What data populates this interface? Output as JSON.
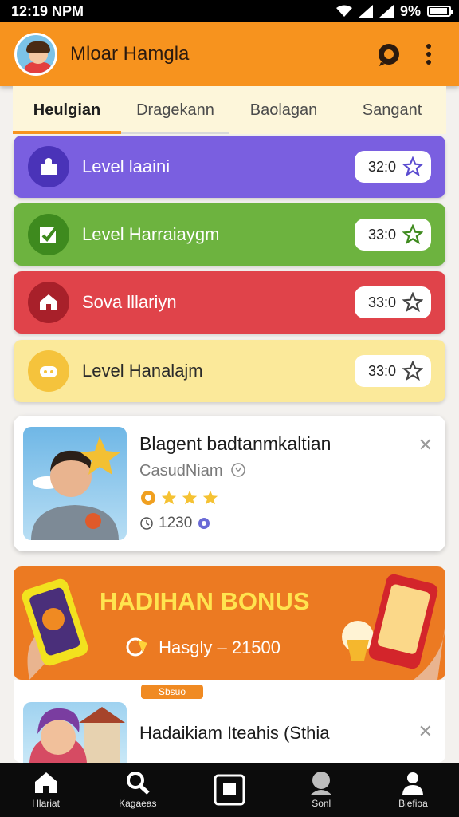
{
  "status_bar": {
    "time": "12:19 NPM",
    "battery": "9%",
    "battery_level": 0.9
  },
  "app_bar": {
    "title": "Mloar Hamgla"
  },
  "tabs": [
    {
      "label": "Heulgian"
    },
    {
      "label": "Dragekann"
    },
    {
      "label": "Baolagan"
    },
    {
      "label": "Sangant"
    }
  ],
  "levels": [
    {
      "label": "Level laaini",
      "count": "32:0",
      "color": "#7a5fe0",
      "icon": "puzzle-icon"
    },
    {
      "label": "Level Harraiaygm",
      "count": "33:0",
      "color": "#6db33f",
      "icon": "check-icon"
    },
    {
      "label": "Sova lllariyn",
      "count": "33:0",
      "color": "#e0434a",
      "icon": "house-icon"
    },
    {
      "label": "Level Hanalajm",
      "count": "33:0",
      "color": "#fbe99a",
      "icon": "game-icon"
    }
  ],
  "profile_card": {
    "title": "Blagent badtanmkaltian",
    "subtitle": "CasudNiam",
    "rating": 3,
    "count": "1230"
  },
  "bonus_banner": {
    "title": "HADIHAN BONUS",
    "subtitle": "Hasgly – 21500"
  },
  "card2": {
    "badge": "Sbsuo",
    "title": "Hadaikiam Iteahis (Sthia"
  },
  "bottom_nav": [
    {
      "label": "Hlariat",
      "icon": "home-icon"
    },
    {
      "label": "Kagaeas",
      "icon": "search-icon"
    },
    {
      "label": "",
      "icon": "square-icon"
    },
    {
      "label": "Sonl",
      "icon": "user-icon"
    },
    {
      "label": "Biefioa",
      "icon": "profile-icon"
    }
  ]
}
